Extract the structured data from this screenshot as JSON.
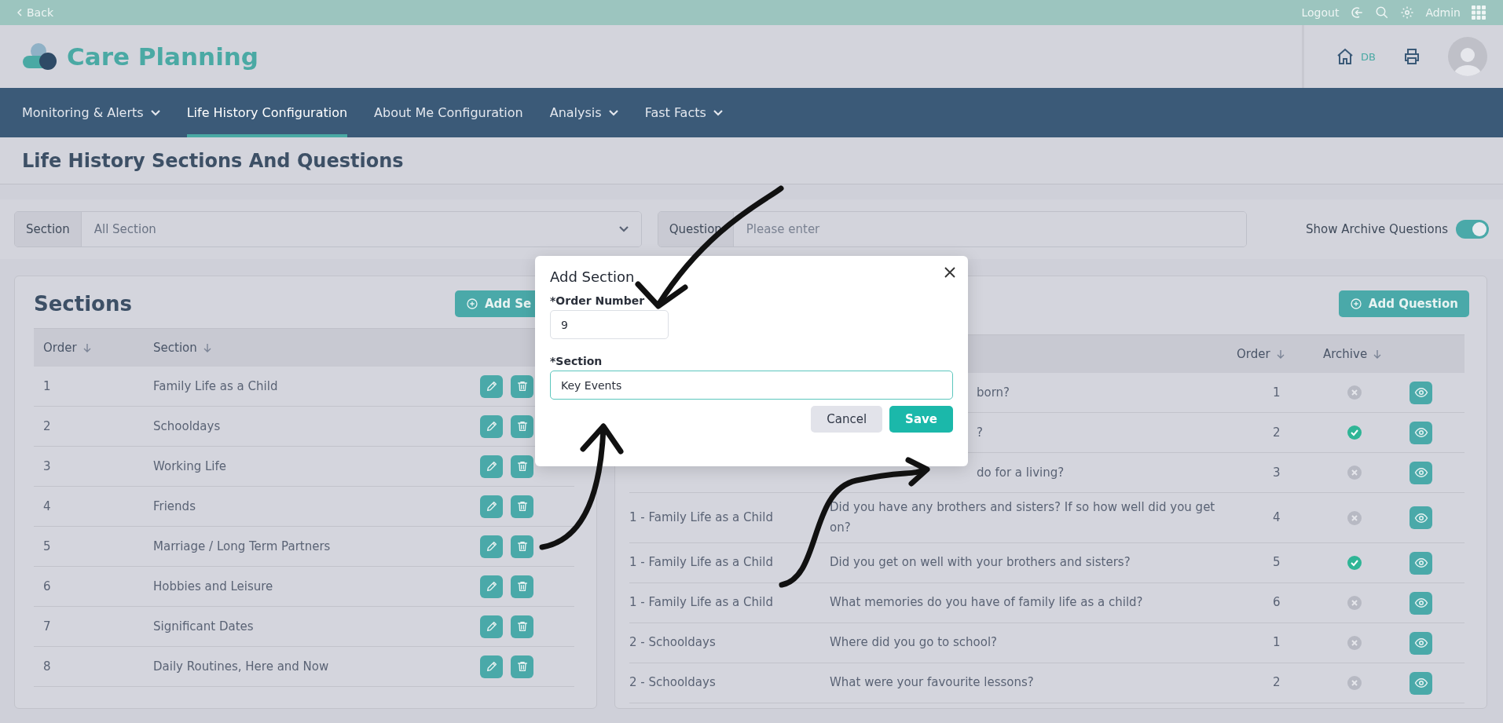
{
  "top_bar": {
    "back": "Back",
    "logout": "Logout",
    "user": "Admin"
  },
  "header": {
    "app_name": "Care Planning",
    "home_label": "DB"
  },
  "nav": [
    {
      "label": "Monitoring & Alerts",
      "has_menu": true,
      "selected": false
    },
    {
      "label": "Life History Configuration",
      "has_menu": false,
      "selected": true
    },
    {
      "label": "About Me Configuration",
      "has_menu": false,
      "selected": false
    },
    {
      "label": "Analysis",
      "has_menu": true,
      "selected": false
    },
    {
      "label": "Fast Facts",
      "has_menu": true,
      "selected": false
    }
  ],
  "page_title": "Life History Sections And Questions",
  "filters": {
    "section_label": "Section",
    "section_value": "All Section",
    "question_label": "Question",
    "question_placeholder": "Please enter",
    "archive_toggle": {
      "label": "Show Archive Questions",
      "on": true
    }
  },
  "sections_panel": {
    "title": "Sections",
    "add_button": "Add Se",
    "columns": [
      "Order",
      "Section"
    ],
    "rows": [
      {
        "order": "1",
        "section": "Family Life as a Child"
      },
      {
        "order": "2",
        "section": "Schooldays"
      },
      {
        "order": "3",
        "section": "Working Life"
      },
      {
        "order": "4",
        "section": "Friends"
      },
      {
        "order": "5",
        "section": "Marriage / Long Term Partners"
      },
      {
        "order": "6",
        "section": "Hobbies and Leisure"
      },
      {
        "order": "7",
        "section": "Significant Dates"
      },
      {
        "order": "8",
        "section": "Daily Routines, Here and Now"
      }
    ]
  },
  "questions_panel": {
    "add_button": "Add Question",
    "columns": [
      "Order",
      "Archive"
    ],
    "rows": [
      {
        "kind": "covered",
        "question": "born?",
        "order": "1",
        "archived": false
      },
      {
        "kind": "covered",
        "question": "?",
        "order": "2",
        "archived": true
      },
      {
        "kind": "covered",
        "question": "do for a living?",
        "order": "3",
        "archived": false
      },
      {
        "kind": "full",
        "section": "1 - Family Life as a Child",
        "question": "Did you have any brothers and sisters? If so how well did you get on?",
        "order": "4",
        "archived": false
      },
      {
        "kind": "full",
        "section": "1 - Family Life as a Child",
        "question": "Did you get on well with your brothers and sisters?",
        "order": "5",
        "archived": true
      },
      {
        "kind": "full",
        "section": "1 - Family Life as a Child",
        "question": "What memories do you have of family life as a child?",
        "order": "6",
        "archived": false
      },
      {
        "kind": "full",
        "section": "2 - Schooldays",
        "question": "Where did you go to school?",
        "order": "1",
        "archived": false
      },
      {
        "kind": "full",
        "section": "2 - Schooldays",
        "question": "What were your favourite lessons?",
        "order": "2",
        "archived": false
      }
    ]
  },
  "modal": {
    "title": "Add Section",
    "order_label": "*Order Number",
    "order_value": "9",
    "section_label": "*Section",
    "section_value": "Key Events",
    "cancel": "Cancel",
    "save": "Save"
  }
}
